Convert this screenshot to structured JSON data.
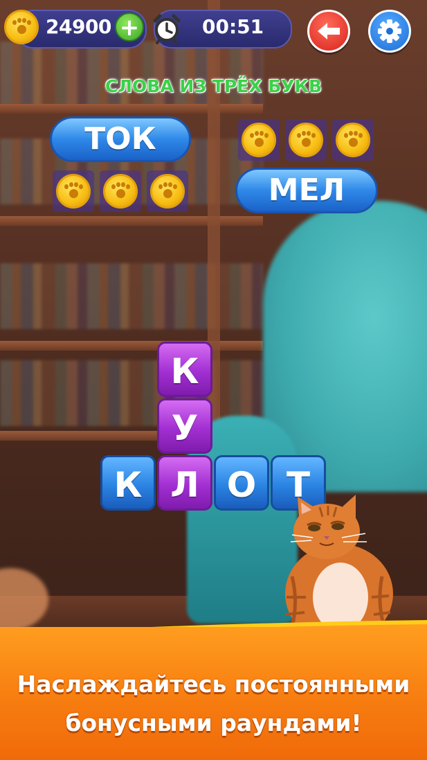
{
  "hud": {
    "coins": "24900",
    "plus": "+",
    "timer": "00:51"
  },
  "level": {
    "title": "СЛОВА ИЗ ТРЁХ БУКВ"
  },
  "found_words": [
    {
      "word": "ТОК",
      "reward_coins": 3
    },
    {
      "word": "МЕЛ",
      "reward_coins": 3
    }
  ],
  "tiles": {
    "vertical": [
      {
        "letter": "К",
        "color": "purple"
      },
      {
        "letter": "У",
        "color": "purple"
      }
    ],
    "horizontal": [
      {
        "letter": "К",
        "color": "blue"
      },
      {
        "letter": "Л",
        "color": "purple"
      },
      {
        "letter": "О",
        "color": "blue"
      },
      {
        "letter": "Т",
        "color": "blue"
      }
    ]
  },
  "banner": {
    "line1": "Наслаждайтесь постоянными",
    "line2": "бонусными раундами!"
  },
  "icons": [
    "paw-coin-icon",
    "plus-icon",
    "alarm-clock-icon",
    "back-arrow-icon",
    "gear-icon"
  ],
  "colors": {
    "title_green": "#3bd14a",
    "tile_purple": "#a22fd2",
    "tile_blue": "#2b84e3",
    "banner_orange": "#f77d10",
    "back_red": "#d8231c",
    "settings_blue": "#1d6fd6"
  }
}
